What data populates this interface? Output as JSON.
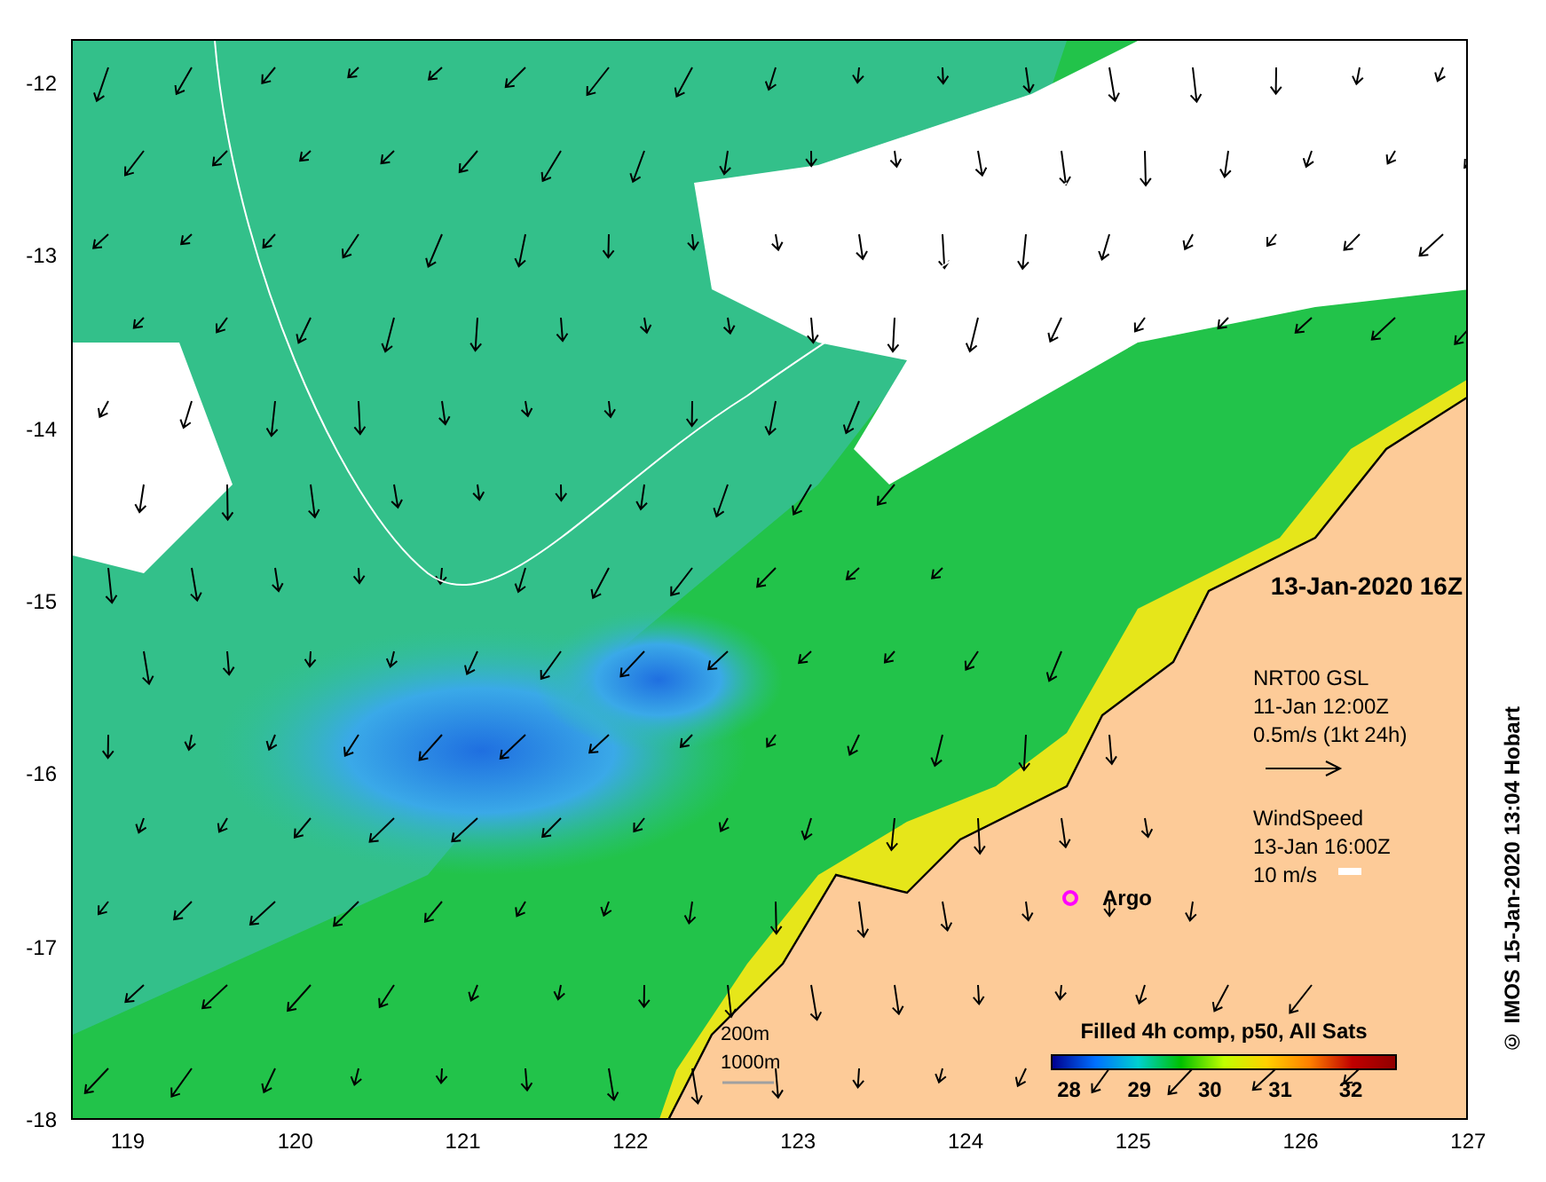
{
  "map": {
    "date_label": "13-Jan-2020 16Z",
    "current_legend": {
      "source": "NRT00 GSL",
      "time": "11-Jan 12:00Z",
      "scale": "0.5m/s (1kt 24h)"
    },
    "wind_legend": {
      "title": "WindSpeed",
      "time": "13-Jan 16:00Z",
      "scale": "10 m/s"
    },
    "argo_label": "Argo",
    "depth_legend": [
      "200m",
      "1000m"
    ],
    "colorbar": {
      "title": "Filled 4h comp, p50, All Sats",
      "ticks": [
        "28",
        "29",
        "30",
        "31",
        "32"
      ]
    }
  },
  "x_ticks": [
    "119",
    "120",
    "121",
    "122",
    "123",
    "124",
    "125",
    "126",
    "127"
  ],
  "y_ticks": [
    "-12",
    "-13",
    "-14",
    "-15",
    "-16",
    "-17",
    "-18"
  ],
  "credit": "© IMOS 15-Jan-2020 13:04 Hobart"
}
